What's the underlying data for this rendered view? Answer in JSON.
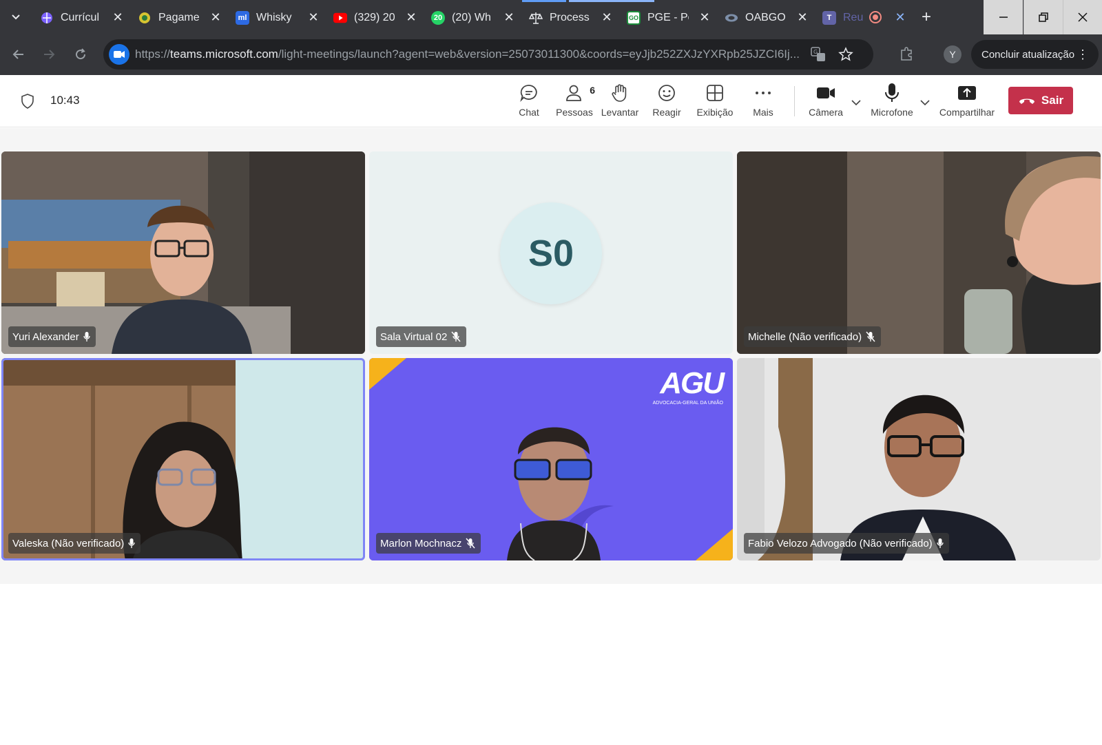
{
  "browser": {
    "tabs": [
      {
        "title": "Currícul",
        "favicon": "globe-icon",
        "favicon_color": "#7b61ff"
      },
      {
        "title": "Pagame",
        "favicon": "pagamento-icon",
        "favicon_color": "#d6c431"
      },
      {
        "title": "Whisky ",
        "favicon": "ml-icon",
        "favicon_color": "#2d6ae3"
      },
      {
        "title": "(329) 20",
        "favicon": "youtube-icon",
        "favicon_color": "#ff0000"
      },
      {
        "title": "(20) Wh",
        "favicon": "whatsapp-icon",
        "favicon_color": "#25d366",
        "badge": "20"
      },
      {
        "title": "Process",
        "favicon": "scales-icon",
        "favicon_color": "#9aa0a6"
      },
      {
        "title": "PGE - Po",
        "favicon": "pge-icon",
        "favicon_color": "#1b8e3b",
        "favicon_text": "GO"
      },
      {
        "title": "OABGO",
        "favicon": "oab-icon",
        "favicon_color": "#7d8fa9"
      },
      {
        "title": "Reu",
        "favicon": "teams-icon",
        "favicon_color": "#6264a7",
        "recording": true
      }
    ],
    "url_scheme": "https://",
    "url_host": "teams.microsoft.com",
    "url_path": "/light-meetings/launch?agent=web&version=25073011300&coords=eyJjb252ZXJzYXRpb25JZCI6Ij...",
    "profile_initial": "Y",
    "update_label": "Concluir atualização"
  },
  "meeting": {
    "time": "10:43",
    "toolbar": {
      "chat": "Chat",
      "people": "Pessoas",
      "people_count": "6",
      "raise": "Levantar",
      "react": "Reagir",
      "view": "Exibição",
      "more": "Mais",
      "camera": "Câmera",
      "mic": "Microfone",
      "share": "Compartilhar",
      "leave": "Sair"
    },
    "participants": [
      {
        "name": "Yuri Alexander",
        "mic": "on"
      },
      {
        "name": "Sala Virtual 02",
        "mic": "muted",
        "initials": "S0"
      },
      {
        "name": "Michelle (Não verificado)",
        "mic": "muted"
      },
      {
        "name": "Valeska (Não verificado)",
        "mic": "on",
        "speaking": true
      },
      {
        "name": "Marlon Mochnacz",
        "mic": "muted",
        "background_text": "AGU",
        "background_subtext": "ADVOCACIA-GERAL DA UNIÃO"
      },
      {
        "name": "Fabio Velozo Advogado (Não verificado)",
        "mic": "on"
      }
    ]
  }
}
